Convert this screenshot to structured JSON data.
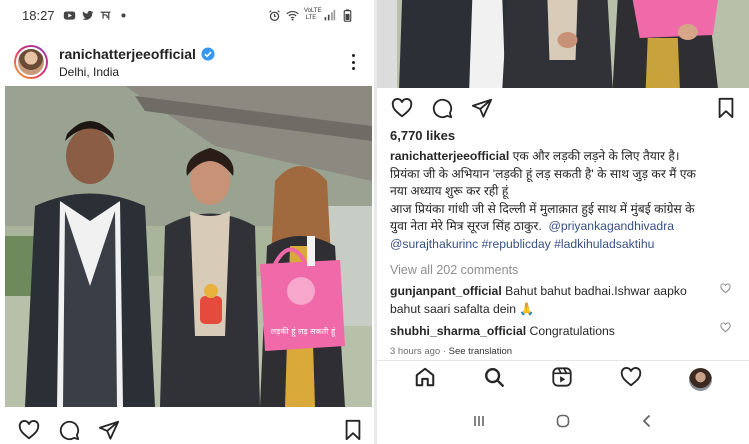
{
  "status_bar": {
    "time": "18:27",
    "network_label": "VoLTE LTE",
    "icons": [
      "youtube-icon",
      "twitter-icon",
      "hindi-app-icon",
      "dot-icon",
      "alarm-icon",
      "wifi-icon",
      "signal-icon",
      "battery-icon"
    ]
  },
  "post": {
    "username": "ranichatterjeeofficial",
    "verified": true,
    "location": "Delhi, India",
    "bag_text": "लड़की हूं लड़ सकती हूं",
    "likes": "6,770 likes",
    "caption": {
      "username": "ranichatterjeeofficial",
      "line1": "एक और लड़की लड़ने के लिए तैयार है।",
      "line2": "प्रियंका जी के अभियान 'लड़की हूं लड़ सकती है' के साथ जुड़ कर मैं एक",
      "line3": "नया अध्याय शुरू कर रही हूं",
      "line4": "आज प्रियंका गांधी जी से दिल्ली में मुलाक़ात हुई साथ में मुंबई कांग्रेस के",
      "line5_text": "युवा नेता मेरे मित्र सूरज सिंह ठाकुर.",
      "tags_line5": "@priyankagandhivadra",
      "tags_line6": "@surajthakurinc #republicday #ladkihuladsaktihu"
    },
    "view_comments": "View all 202 comments",
    "comments": [
      {
        "user": "gunjanpant_official",
        "text_line1": "Bahut bahut badhai.Ishwar aapko",
        "text_line2": "bahut saari safalta dein 🙏"
      },
      {
        "user": "shubhi_sharma_official",
        "text": "Congratulations"
      }
    ],
    "time_ago": "3 hours ago",
    "see_translation": "See translation"
  },
  "nav": [
    "home-icon",
    "search-icon",
    "reels-icon",
    "activity-heart-icon",
    "profile-avatar"
  ],
  "colors": {
    "link": "#385185",
    "verified": "#3897f0",
    "muted": "#8e8e8e",
    "bag_pink": "#f06aa9"
  }
}
